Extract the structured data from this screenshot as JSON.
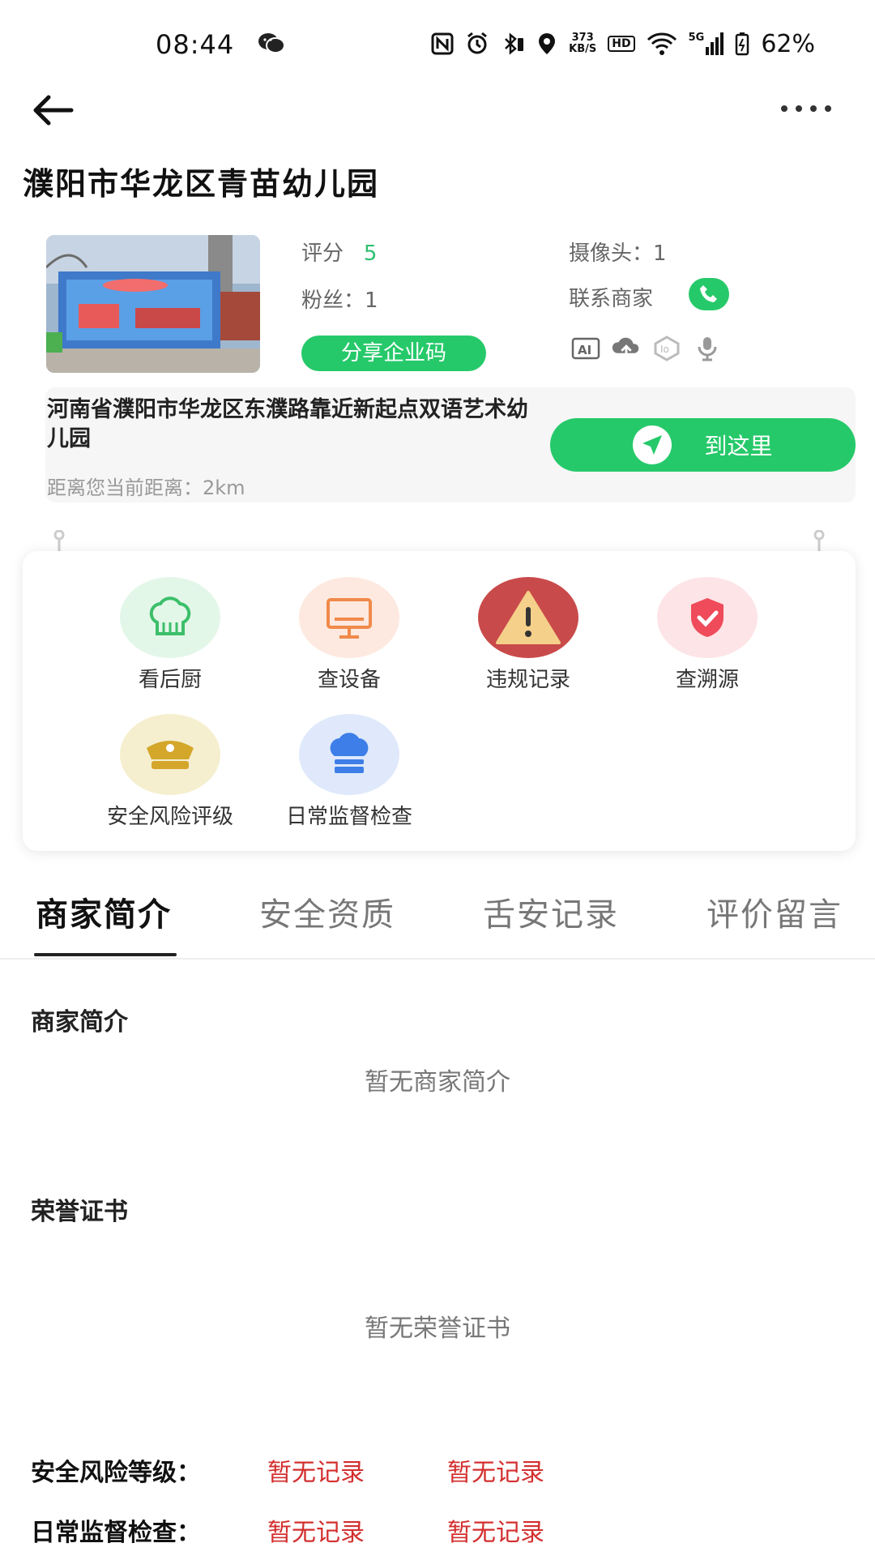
{
  "status": {
    "time": "08:44",
    "net_speed_top": "373",
    "net_speed_bottom": "KB/S",
    "hd": "HD",
    "net_type": "5G",
    "battery": "62%"
  },
  "merchant": {
    "name": "濮阳市华龙区青苗幼儿园",
    "score_label": "评分",
    "score_value": "5",
    "fans_label": "粉丝：",
    "fans_value": "1",
    "camera_label": "摄像头：",
    "camera_value": "1",
    "contact_label": "联系商家",
    "share_button": "分享企业码",
    "address": "河南省濮阳市华龙区东濮路靠近新起点双语艺术幼儿园",
    "distance": "距离您当前距离：2km",
    "goto_button": "到这里",
    "feature_icons": [
      "ai-icon",
      "cloud-upload-icon",
      "iot-icon",
      "microphone-icon"
    ]
  },
  "functions": [
    {
      "label": "看后厨",
      "icon": "chef-hat-icon",
      "color": "#e3f7e9"
    },
    {
      "label": "查设备",
      "icon": "monitor-icon",
      "color": "#fde9df"
    },
    {
      "label": "违规记录",
      "icon": "warning-icon",
      "color": "#c94a4a"
    },
    {
      "label": "查溯源",
      "icon": "shield-check-icon",
      "color": "#fde4e6"
    },
    {
      "label": "安全风险评级",
      "icon": "police-cap-icon",
      "color": "#f5efcf"
    },
    {
      "label": "日常监督检查",
      "icon": "chef-hat-blue-icon",
      "color": "#dfe9fb"
    }
  ],
  "tabs": [
    "商家简介",
    "安全资质",
    "舌安记录",
    "评价留言"
  ],
  "intro": {
    "heading": "商家简介",
    "empty": "暂无商家简介"
  },
  "honors": {
    "heading": "荣誉证书",
    "empty": "暂无荣誉证书"
  },
  "risk": {
    "label": "安全风险等级：",
    "value1": "暂无记录",
    "value2": "暂无记录"
  },
  "inspection": {
    "label": "日常监督检查：",
    "value1": "暂无记录",
    "value2": "暂无记录"
  },
  "colors": {
    "accent": "#26c96a",
    "warning_text": "#d32f2f"
  }
}
